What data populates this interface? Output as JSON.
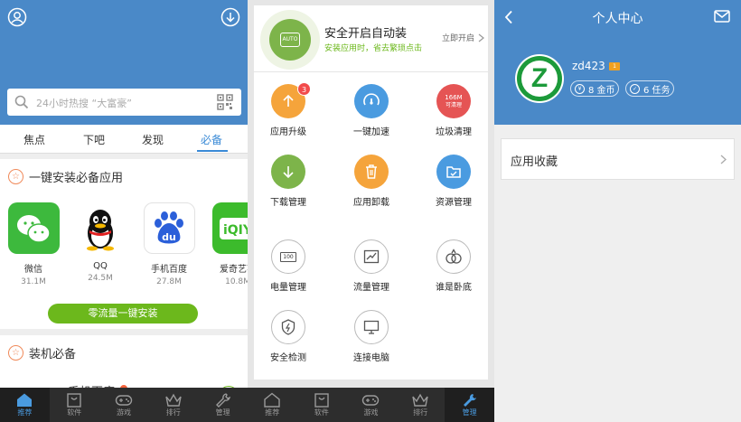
{
  "left": {
    "search_placeholder": "24小时热搜 “大富豪”",
    "tabs": [
      "焦点",
      "下吧",
      "发现",
      "必备"
    ],
    "section1_title": "一键安装必备应用",
    "apps": [
      {
        "name": "微信",
        "size": "31.1M"
      },
      {
        "name": "QQ",
        "size": "24.5M"
      },
      {
        "name": "手机百度",
        "size": "27.8M"
      },
      {
        "name": "爱奇艺花",
        "size": "10.8M"
      }
    ],
    "install_button": "零流量一键安装",
    "section2_title": "装机必备",
    "partial_app_name": "手机百度"
  },
  "middle": {
    "banner_title": "安全开启自动装",
    "banner_sub": "安装应用时，省去繁琐点击",
    "banner_action": "立即开启",
    "auto_label": "AUTO",
    "tools": [
      {
        "label": "应用升级",
        "badge": "3"
      },
      {
        "label": "一键加速"
      },
      {
        "label": "垃圾清理",
        "badge_top": "166M",
        "badge_bottom": "可清理"
      },
      {
        "label": "下载管理"
      },
      {
        "label": "应用卸载"
      },
      {
        "label": "资源管理"
      },
      {
        "label": "电量管理",
        "battery": "100"
      },
      {
        "label": "流量管理"
      },
      {
        "label": "谁是卧底"
      },
      {
        "label": "安全检测"
      },
      {
        "label": "连接电脑"
      }
    ]
  },
  "right": {
    "title": "个人中心",
    "username": "zd423",
    "level": "1",
    "coins": "8 金币",
    "tasks": "6 任务",
    "favorite": "应用收藏"
  },
  "tabbar": [
    "推荐",
    "软件",
    "游戏",
    "排行",
    "管理"
  ]
}
